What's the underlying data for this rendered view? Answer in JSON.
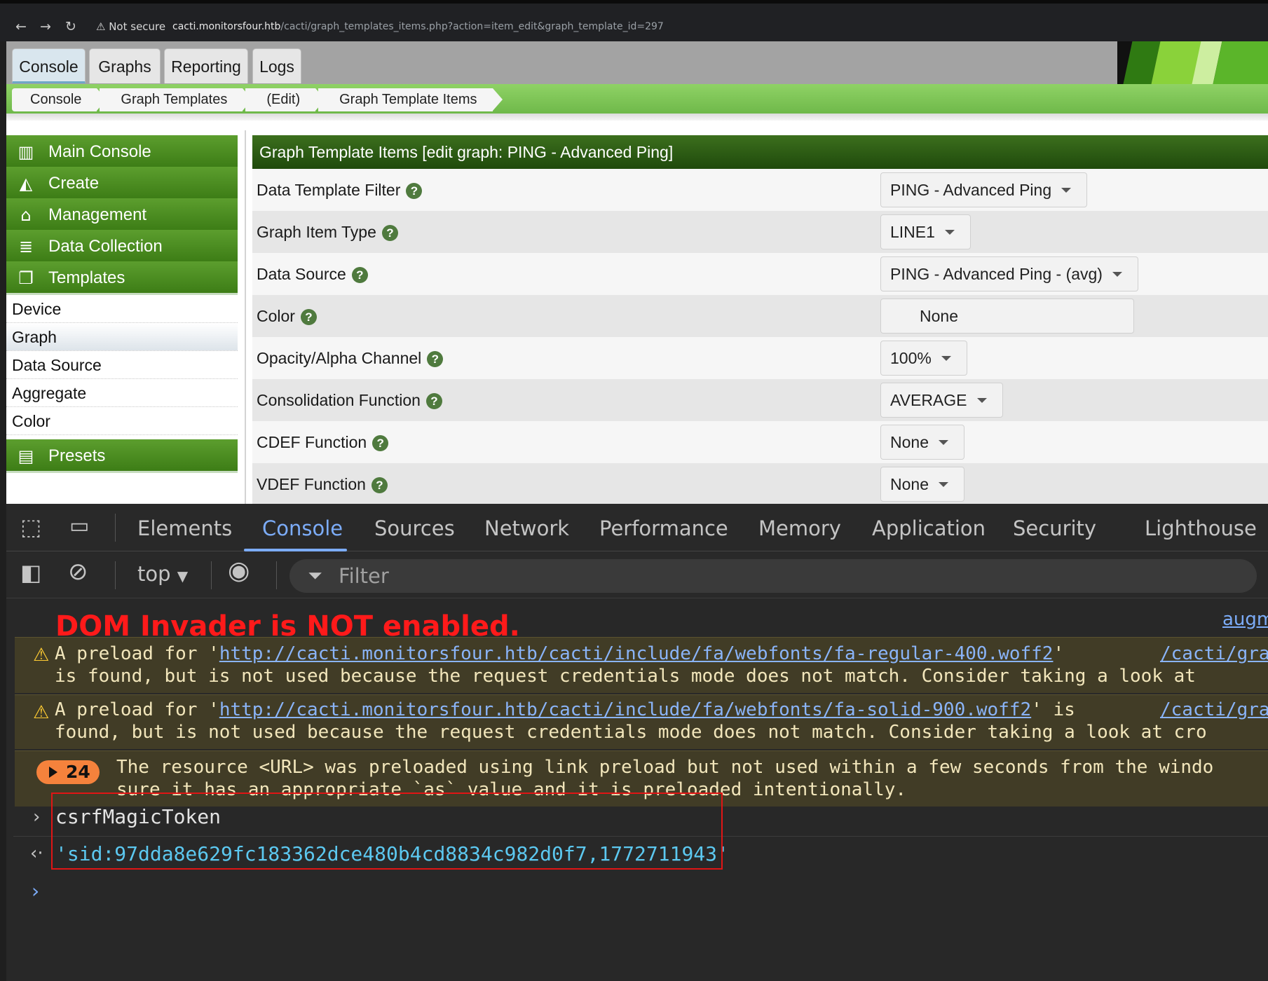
{
  "browser": {
    "back": "←",
    "forward": "→",
    "reload": "↻",
    "security": "⚠ Not secure",
    "host": "cacti.monitorsfour.htb",
    "path": "/cacti/graph_templates_items.php?action=item_edit&graph_template_id=297"
  },
  "tabs": [
    "Console",
    "Graphs",
    "Reporting",
    "Logs"
  ],
  "breadcrumbs": [
    "Console",
    "Graph Templates",
    "(Edit)",
    "Graph Template Items"
  ],
  "sidebar": {
    "main_console": "Main Console",
    "create": "Create",
    "management": "Management",
    "data_collection": "Data Collection",
    "templates": "Templates",
    "template_items": [
      "Device",
      "Graph",
      "Data Source",
      "Aggregate",
      "Color"
    ],
    "presets": "Presets"
  },
  "panel": {
    "title": "Graph Template Items [edit graph: PING - Advanced Ping]",
    "rows": [
      {
        "label": "Data Template Filter",
        "value": "PING - Advanced Ping"
      },
      {
        "label": "Graph Item Type",
        "value": "LINE1"
      },
      {
        "label": "Data Source",
        "value": "PING - Advanced Ping - (avg)"
      },
      {
        "label": "Color",
        "value": "None"
      },
      {
        "label": "Opacity/Alpha Channel",
        "value": "100%"
      },
      {
        "label": "Consolidation Function",
        "value": "AVERAGE"
      },
      {
        "label": "CDEF Function",
        "value": "None"
      },
      {
        "label": "VDEF Function",
        "value": "None"
      }
    ],
    "help_glyph": "?"
  },
  "devtools": {
    "tabs": [
      "Elements",
      "Console",
      "Sources",
      "Network",
      "Performance",
      "Memory",
      "Application",
      "Security",
      "Lighthouse"
    ],
    "context": "top",
    "filter_placeholder": "Filter",
    "banner": "DOM Invader is NOT enabled.",
    "banner_link": "augm",
    "messages": {
      "warn1_prefix": "A preload for '",
      "warn1_url": "http://cacti.monitorsfour.htb/cacti/include/fa/webfonts/fa-regular-400.woff2",
      "warn1_suffix": "'",
      "warn1_line2": "is found, but is not used because the request credentials mode does not match. Consider taking a look at",
      "warn1_src": "/cacti/gra",
      "warn2_prefix": "A preload for '",
      "warn2_url": "http://cacti.monitorsfour.htb/cacti/include/fa/webfonts/fa-solid-900.woff2",
      "warn2_suffix": "' is",
      "warn2_line2": "found, but is not used because the request credentials mode does not match. Consider taking a look at cro",
      "warn2_src": "/cacti/gra",
      "group_count": "24",
      "group_line1": "The resource <URL> was preloaded using link preload but not used within a few seconds from the windo",
      "group_line2": "sure it has an appropriate `as` value and it is preloaded intentionally."
    },
    "input": "csrfMagicToken",
    "output": "'sid:97dda8e629fc183362dce480b4cd8834c982d0f7,1772711943'"
  }
}
